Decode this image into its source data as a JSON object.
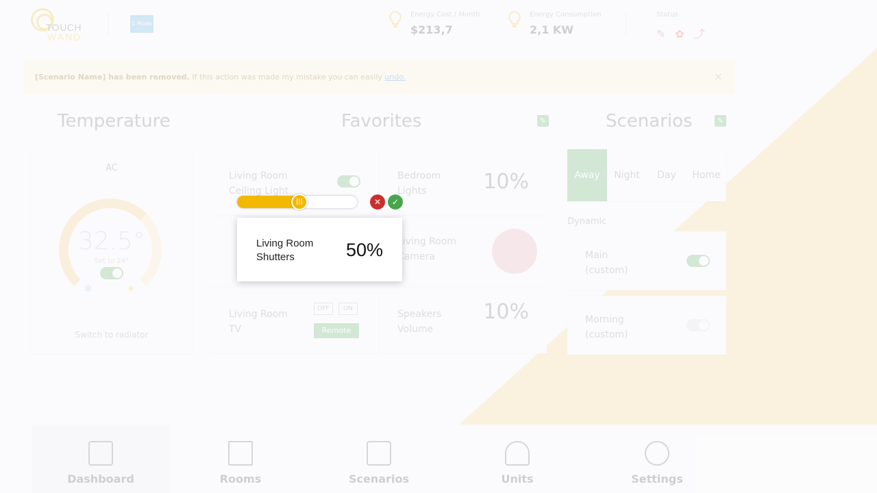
{
  "header": {
    "logo_line1": "TOUCH",
    "logo_line2": "WAND",
    "tag": "1 Mode",
    "energy_cost_label": "Energy Cost / Month",
    "energy_cost_value": "$213,7",
    "energy_consumption_label": "Energy Consumption",
    "energy_consumption_value": "2,1 KW",
    "status_label": "Status"
  },
  "notice": {
    "name": "[Scenario Name] has been removed.",
    "text": " If this action was made my mistake you can easily ",
    "link": "undo.",
    "close": "×"
  },
  "sections": {
    "temperature": "Temperature",
    "favorites": "Favorites",
    "scenarios": "Scenarios"
  },
  "temperature_card": {
    "mode": "AC",
    "value": "32.5°",
    "sub": "Set to 24°",
    "switch_label": "Switch to radiator"
  },
  "favorites": {
    "ceiling_light_line1": "Living Room",
    "ceiling_light_line2": "Ceiling Light",
    "bedroom_line1": "Bedroom",
    "bedroom_line2": "Lights",
    "bedroom_value": "10%",
    "camera_line1": "Living Room",
    "camera_line2": "Camera",
    "tv_line1": "Living Room",
    "tv_line2": "TV",
    "tv_off": "OFF",
    "tv_on": "ON",
    "tv_remote": "Remote",
    "speakers_line1": "Speakers",
    "speakers_line2": "Volume",
    "speakers_value": "10%"
  },
  "scenarios": {
    "tabs": [
      "Away",
      "Night",
      "Day",
      "Home"
    ],
    "dynamic_label": "Dynamic",
    "main_line1": "Main",
    "main_line2": "(custom)",
    "morning_line1": "Morning",
    "morning_line2": "(custom)"
  },
  "nav": {
    "items": [
      "Dashboard",
      "Rooms",
      "Scenarios",
      "Units",
      "Settings"
    ]
  },
  "popup": {
    "name_line1": "Living Room",
    "name_line2": "Shutters",
    "value": "50%",
    "slider_level": 0.52,
    "knob_glyph": "|||"
  },
  "colors": {
    "accent_yellow": "#f3b800",
    "green": "#48a54c",
    "red": "#c9302c"
  }
}
